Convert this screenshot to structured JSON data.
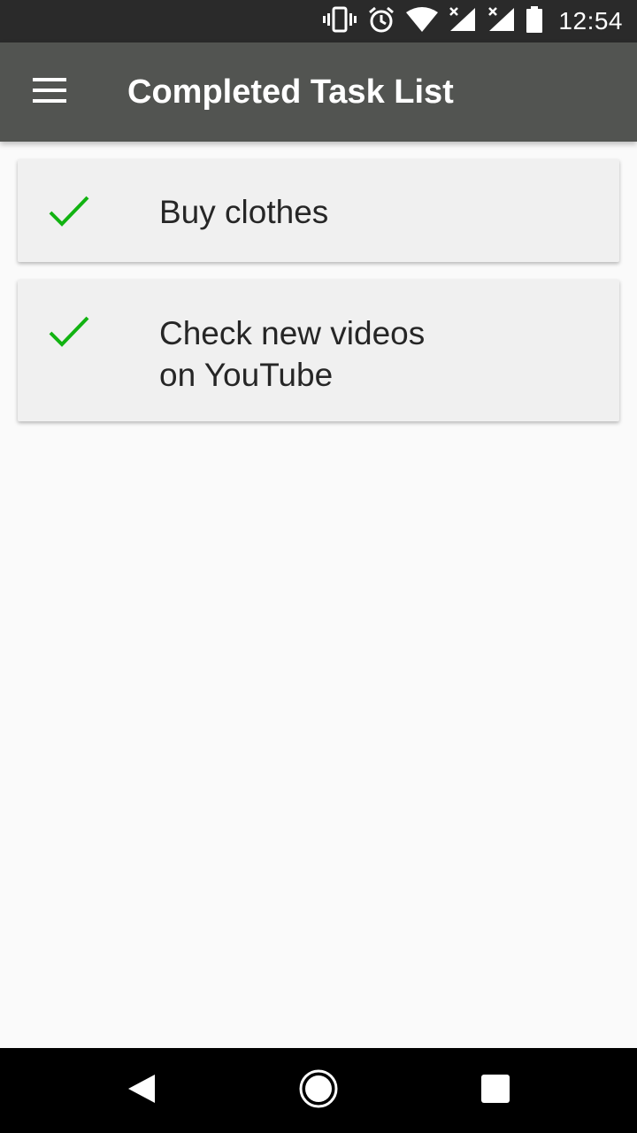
{
  "status_bar": {
    "time": "12:54",
    "icons": [
      "vibrate-icon",
      "alarm-icon",
      "wifi-icon",
      "signal-icon",
      "signal-icon",
      "battery-icon"
    ]
  },
  "app_bar": {
    "title": "Completed Task List",
    "menu_icon": "hamburger-menu-icon",
    "background": "#525451"
  },
  "tasks": [
    {
      "text": "Buy clothes",
      "completed": true
    },
    {
      "text": "Check new videos\non YouTube",
      "completed": true
    }
  ],
  "colors": {
    "check": "#12b312",
    "card": "#f0f0f0",
    "page": "#fafafa"
  },
  "nav_bar": {
    "buttons": [
      "back-icon",
      "home-icon",
      "recents-icon"
    ]
  }
}
